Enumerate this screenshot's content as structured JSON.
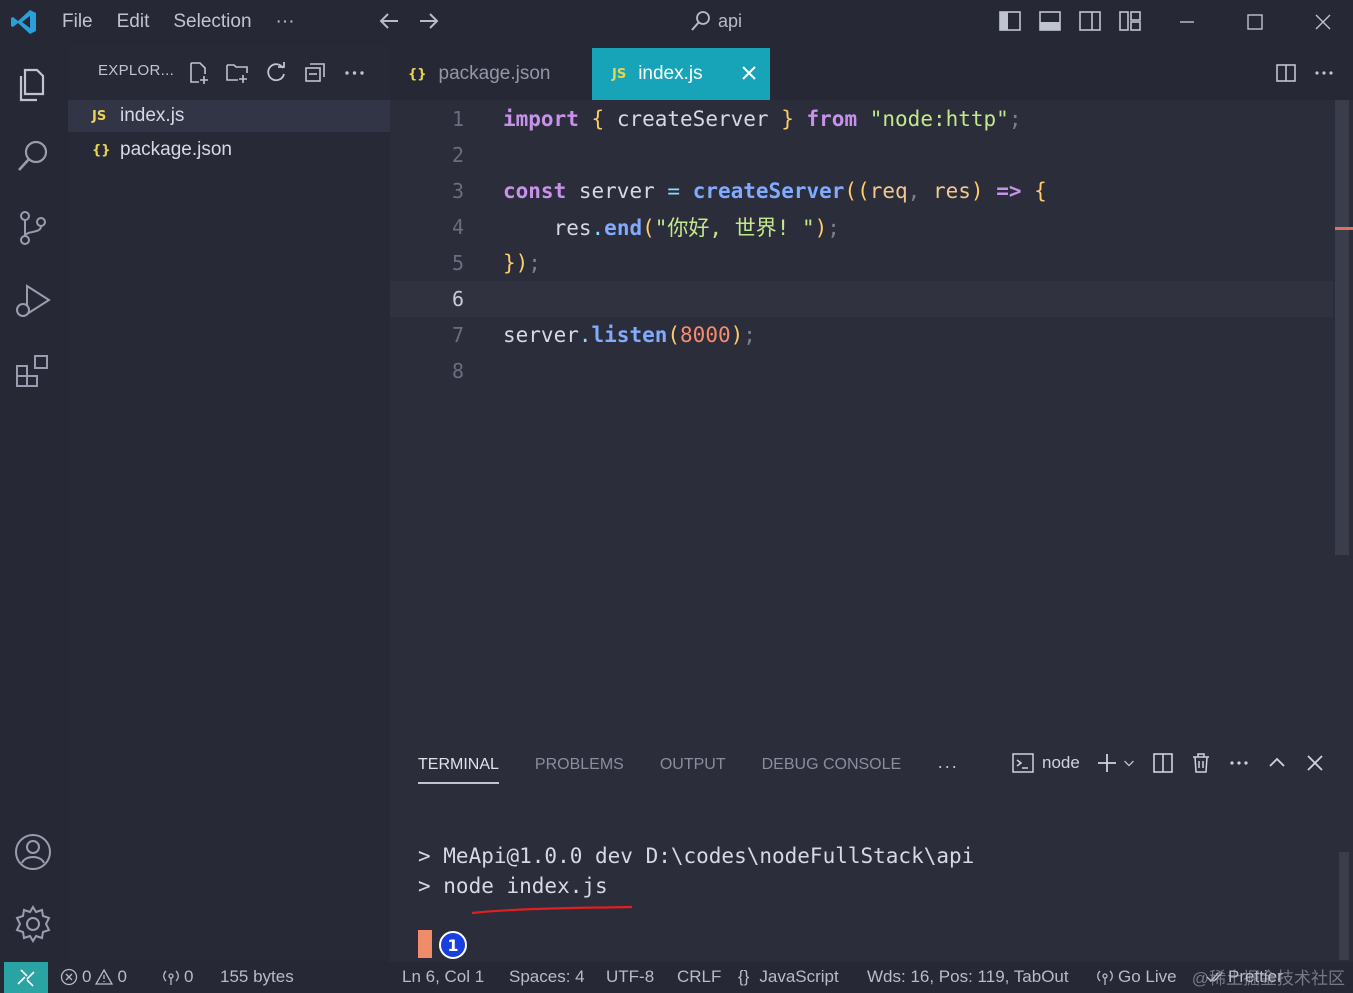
{
  "menu": {
    "file": "File",
    "edit": "Edit",
    "selection": "Selection",
    "more": "···"
  },
  "search": {
    "text": "api"
  },
  "sidebar": {
    "title": "EXPLOR...",
    "files": [
      {
        "icon": "JS",
        "name": "index.js"
      },
      {
        "icon": "{}",
        "name": "package.json"
      }
    ]
  },
  "tabs": [
    {
      "icon": "{}",
      "label": "package.json"
    },
    {
      "icon": "JS",
      "label": "index.js"
    }
  ],
  "editor": {
    "line_numbers": [
      "1",
      "2",
      "3",
      "4",
      "5",
      "6",
      "7",
      "8"
    ],
    "lines": {
      "l1": {
        "import": "import",
        "open": "{",
        "name": "createServer",
        "close": "}",
        "from": "from",
        "module": "\"node:http\"",
        "semi": ";"
      },
      "l3": {
        "const": "const",
        "var": "server",
        "eq": "=",
        "fn": "createServer",
        "open": "((",
        "req": "req",
        "comma": ",",
        "res": "res",
        "close": ")",
        "arrow": "=>",
        "brace": "{"
      },
      "l4": {
        "obj": "res",
        "dot": ".",
        "fn": "end",
        "open": "(",
        "str": "\"你好, 世界! \"",
        "close": ")",
        "semi": ";"
      },
      "l5": {
        "close": "})",
        "semi": ";"
      },
      "l7": {
        "obj": "server",
        "dot": ".",
        "fn": "listen",
        "open": "(",
        "num": "8000",
        "close": ")",
        "semi": ";"
      }
    }
  },
  "panel": {
    "tabs": [
      "TERMINAL",
      "PROBLEMS",
      "OUTPUT",
      "DEBUG CONSOLE"
    ],
    "more": "···",
    "shell": "node",
    "terminal_lines": [
      "> MeApi@1.0.0 dev D:\\codes\\nodeFullStack\\api",
      "> node index.js"
    ],
    "badge": "1"
  },
  "status": {
    "errors": "0",
    "warnings": "0",
    "ports": "0",
    "size": "155 bytes",
    "position": "Ln 6, Col 1",
    "spaces": "Spaces: 4",
    "encoding": "UTF-8",
    "eol": "CRLF",
    "language_icon": "{}",
    "language": "JavaScript",
    "wordcount": "Wds: 16, Pos: 119, TabOut",
    "golive": "Go Live",
    "prettier": "Prettier",
    "watermark": "@稀土掘金技术社区"
  },
  "colors": {
    "accent": "#18a4b8",
    "remote": "#2aa3a3",
    "cursor": "#f08c6a",
    "badge": "#1a3fe0"
  }
}
